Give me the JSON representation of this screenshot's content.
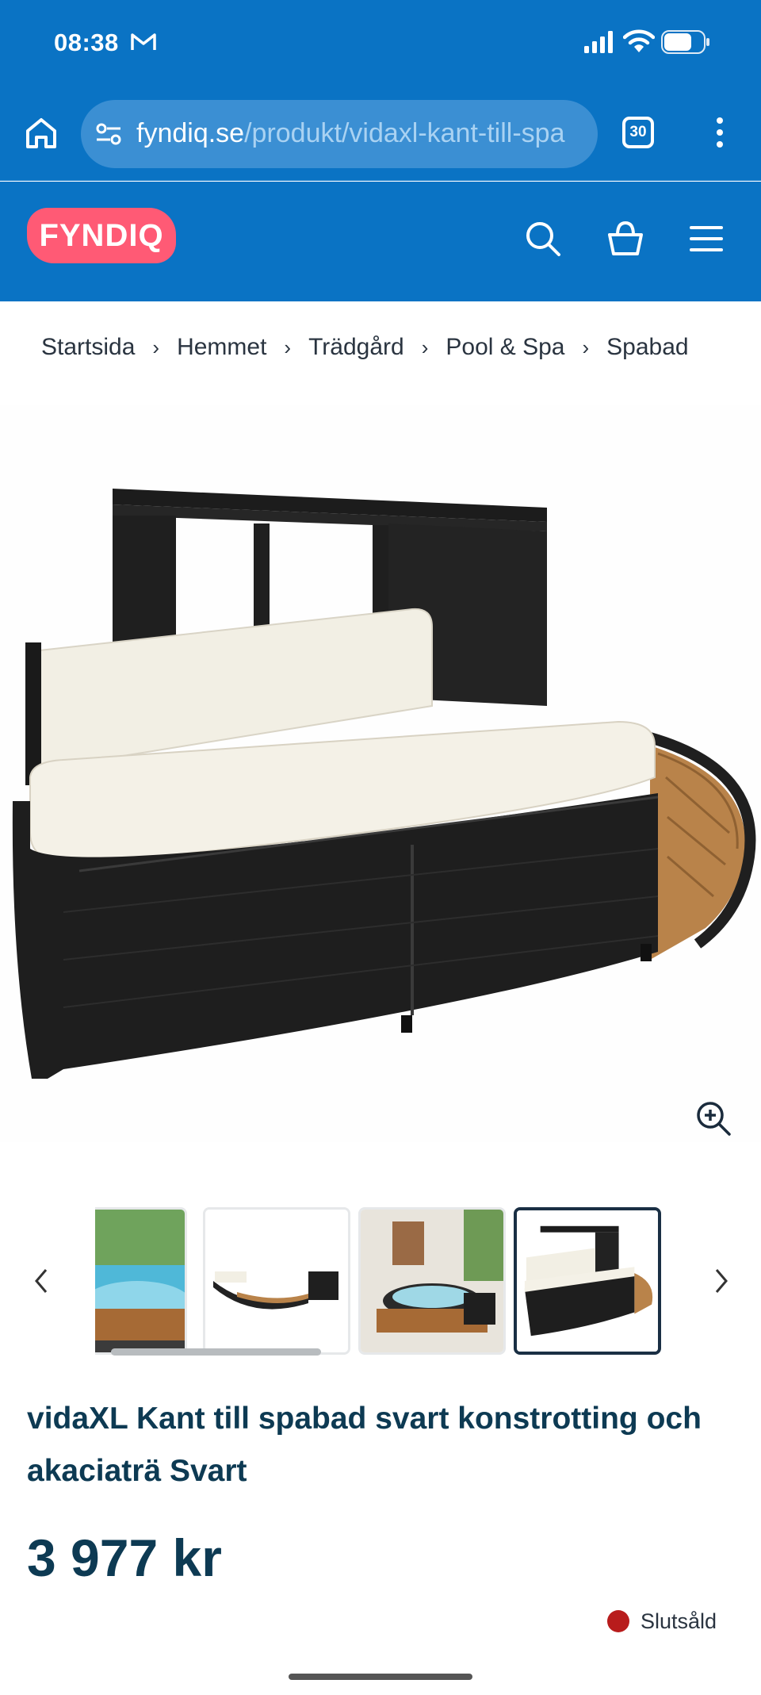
{
  "status_bar": {
    "time": "08:38",
    "icons": [
      "mail-icon",
      "signal-icon",
      "wifi-icon",
      "battery-icon"
    ]
  },
  "browser": {
    "url_domain": "fyndiq.se",
    "url_path": "/produkt/vidaxl-kant-till-spa",
    "tab_count": "30",
    "icons": [
      "home-icon",
      "site-settings-icon",
      "more-vertical-icon"
    ]
  },
  "header": {
    "logo_text": "FYNDIQ",
    "icons": [
      "search-icon",
      "basket-icon",
      "menu-icon"
    ],
    "brand_color": "#0a73c4",
    "logo_color": "#ff5a75"
  },
  "breadcrumb": [
    "Startsida",
    "Hemmet",
    "Trädgård",
    "Pool & Spa",
    "Spabad"
  ],
  "gallery": {
    "thumbnail_count": 4,
    "active_thumbnail": 4,
    "icons": [
      "zoom-in-icon",
      "chevron-left-icon",
      "chevron-right-icon"
    ]
  },
  "product": {
    "title": "vidaXL Kant till spabad svart konstrotting och akaciaträ Svart",
    "price": "3 977 kr",
    "stock_status": "Slutsåld",
    "stock_color": "#b81c1c"
  }
}
